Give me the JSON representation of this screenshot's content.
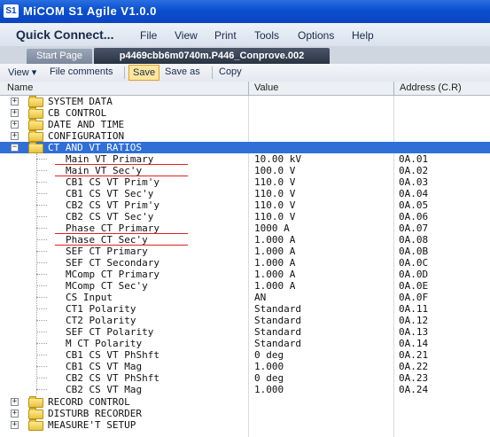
{
  "app": {
    "logo": "S1",
    "title": "MiCOM S1 Agile V1.0.0"
  },
  "menu": {
    "quick_connect": "Quick Connect...",
    "file": "File",
    "view": "View",
    "print": "Print",
    "tools": "Tools",
    "options": "Options",
    "help": "Help"
  },
  "tabs": {
    "start": "Start Page",
    "active": "p4469cbb6m0740m.P446_Conprove.002"
  },
  "toolbar": {
    "view": "View",
    "file_comments": "File comments",
    "save": "Save",
    "save_as": "Save as",
    "copy": "Copy"
  },
  "columns": {
    "name": "Name",
    "value": "Value",
    "address": "Address (C.R)"
  },
  "rows": [
    {
      "name": "SYSTEM DATA",
      "value": "",
      "addr": ""
    },
    {
      "name": "CB CONTROL",
      "value": "",
      "addr": ""
    },
    {
      "name": "DATE AND TIME",
      "value": "",
      "addr": ""
    },
    {
      "name": "CONFIGURATION",
      "value": "",
      "addr": ""
    },
    {
      "name": "CT AND VT RATIOS",
      "value": "",
      "addr": ""
    },
    {
      "name": "Main VT Primary",
      "value": "10.00 kV",
      "addr": "0A.01"
    },
    {
      "name": "Main VT Sec'y",
      "value": "100.0 V",
      "addr": "0A.02"
    },
    {
      "name": "CB1 CS VT Prim'y",
      "value": "110.0 V",
      "addr": "0A.03"
    },
    {
      "name": "CB1 CS VT Sec'y",
      "value": "110.0 V",
      "addr": "0A.04"
    },
    {
      "name": "CB2 CS VT Prim'y",
      "value": "110.0 V",
      "addr": "0A.05"
    },
    {
      "name": "CB2 CS VT Sec'y",
      "value": "110.0 V",
      "addr": "0A.06"
    },
    {
      "name": "Phase CT Primary",
      "value": "1000 A",
      "addr": "0A.07"
    },
    {
      "name": "Phase CT Sec'y",
      "value": "1.000 A",
      "addr": "0A.08"
    },
    {
      "name": "SEF CT Primary",
      "value": "1.000 A",
      "addr": "0A.0B"
    },
    {
      "name": "SEF CT Secondary",
      "value": "1.000 A",
      "addr": "0A.0C"
    },
    {
      "name": "MComp CT Primary",
      "value": "1.000 A",
      "addr": "0A.0D"
    },
    {
      "name": "MComp CT Sec'y",
      "value": "1.000 A",
      "addr": "0A.0E"
    },
    {
      "name": "CS Input",
      "value": "AN",
      "addr": "0A.0F"
    },
    {
      "name": "CT1 Polarity",
      "value": "Standard",
      "addr": "0A.11"
    },
    {
      "name": "CT2 Polarity",
      "value": "Standard",
      "addr": "0A.12"
    },
    {
      "name": "SEF CT Polarity",
      "value": "Standard",
      "addr": "0A.13"
    },
    {
      "name": "M CT Polarity",
      "value": "Standard",
      "addr": "0A.14"
    },
    {
      "name": "CB1 CS VT PhShft",
      "value": "0 deg",
      "addr": "0A.21"
    },
    {
      "name": "CB1 CS VT Mag",
      "value": "1.000",
      "addr": "0A.22"
    },
    {
      "name": "CB2 CS VT PhShft",
      "value": "0 deg",
      "addr": "0A.23"
    },
    {
      "name": "CB2 CS VT Mag",
      "value": "1.000",
      "addr": "0A.24"
    },
    {
      "name": "RECORD CONTROL",
      "value": "",
      "addr": ""
    },
    {
      "name": "DISTURB RECORDER",
      "value": "",
      "addr": ""
    },
    {
      "name": "MEASURE'T SETUP",
      "value": "",
      "addr": ""
    }
  ],
  "colors": {
    "selection": "#2f6fd6",
    "underline": "#e02020",
    "titlebar": "#0a4fcf"
  }
}
